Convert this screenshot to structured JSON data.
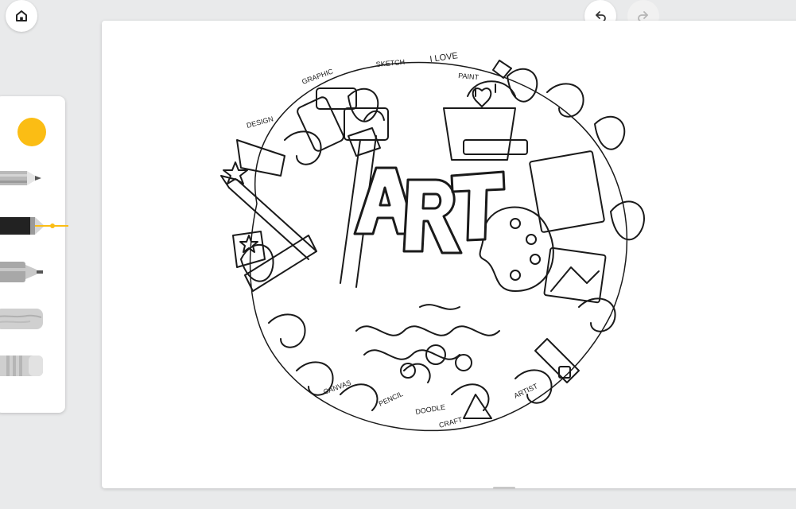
{
  "toolbar": {
    "home_icon": "home-icon",
    "undo_icon": "undo-icon",
    "redo_icon": "redo-icon"
  },
  "tools": {
    "selected_color": "#fbbd14",
    "items": [
      {
        "name": "pencil",
        "icon": "pencil-icon"
      },
      {
        "name": "fountain-pen",
        "icon": "fountain-pen-icon",
        "selected": true
      },
      {
        "name": "marker",
        "icon": "marker-icon"
      },
      {
        "name": "chalk",
        "icon": "chalk-icon"
      },
      {
        "name": "eraser",
        "icon": "eraser-icon"
      }
    ]
  },
  "artwork": {
    "title": "ART",
    "words": [
      "I LOVE",
      "SKETCH",
      "GRAPHIC",
      "DESIGN",
      "PAINT",
      "CANVAS",
      "PENCIL",
      "DOODLE",
      "CRAFT",
      "ARTIST"
    ]
  },
  "colors": {
    "accent": "#fbbd14",
    "background": "#e9eaeb",
    "canvas": "#ffffff"
  }
}
